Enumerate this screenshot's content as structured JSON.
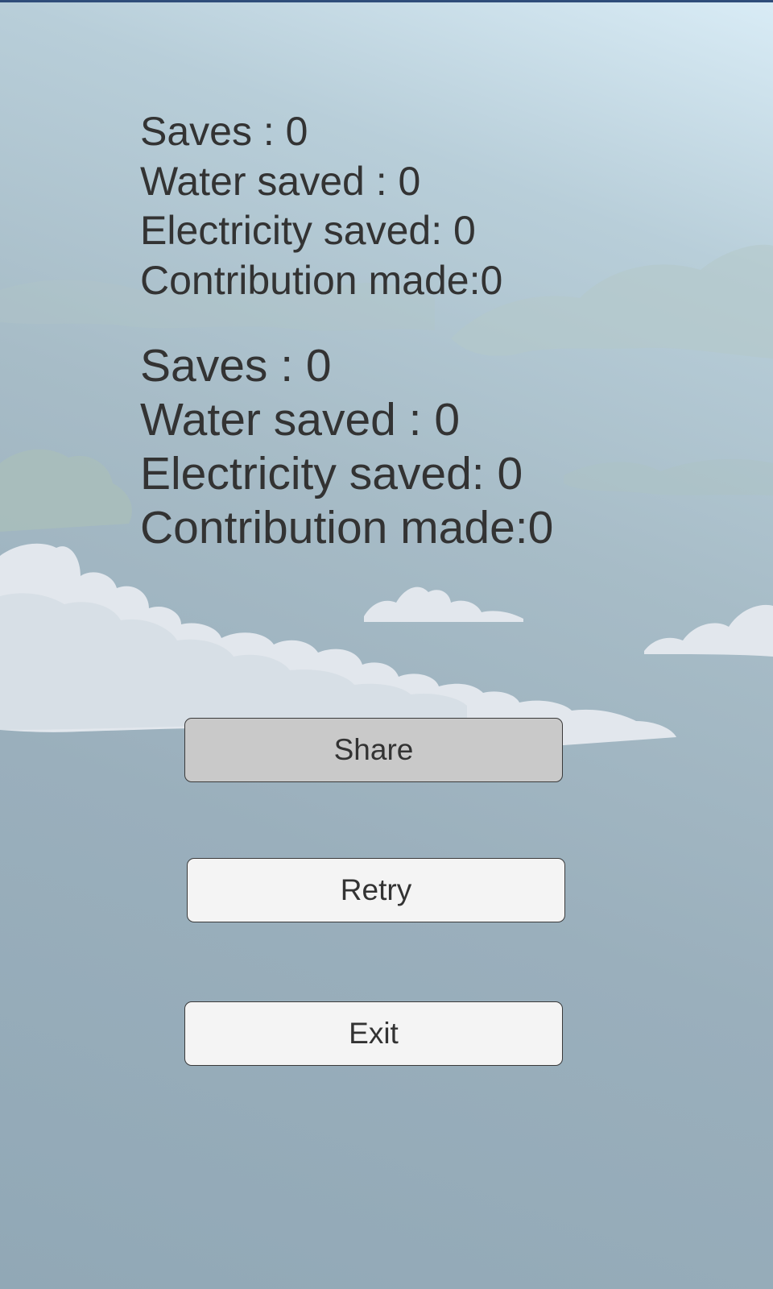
{
  "stats_primary": {
    "saves": "Saves : 0",
    "water": "Water saved : 0",
    "electricity": "Electricity saved: 0",
    "contribution": "Contribution made:0"
  },
  "stats_secondary": {
    "saves": "Saves : 0",
    "water": "Water saved : 0",
    "electricity": "Electricity saved: 0",
    "contribution": "Contribution made:0"
  },
  "buttons": {
    "share": "Share",
    "retry": "Retry",
    "exit": "Exit"
  },
  "colors": {
    "sky_top": "#d9ecf6",
    "sky_bottom": "#91a8b6",
    "text": "#333333",
    "share_button_bg": "#c9c9c9",
    "button_bg": "#f4f4f4"
  }
}
